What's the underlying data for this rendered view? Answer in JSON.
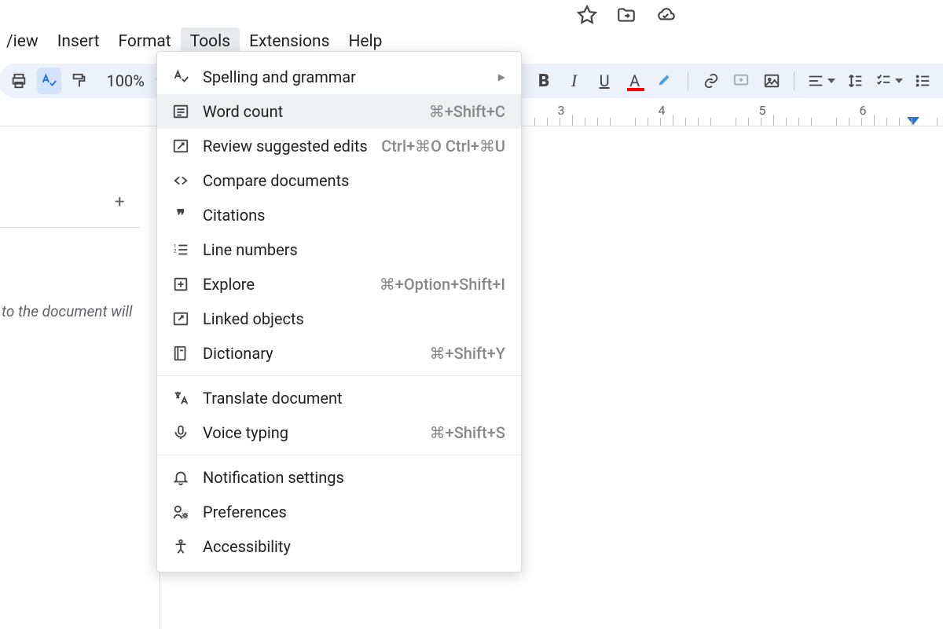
{
  "browser": {
    "star_icon": "star",
    "move_icon": "folder-arrow",
    "cloud_icon": "cloud-check"
  },
  "menubar": {
    "items": [
      {
        "label": "/iew"
      },
      {
        "label": "Insert"
      },
      {
        "label": "Format"
      },
      {
        "label": "Tools",
        "active": true
      },
      {
        "label": "Extensions"
      },
      {
        "label": "Help"
      }
    ]
  },
  "toolbar": {
    "zoom": "100%"
  },
  "ruler": {
    "labels": [
      "3",
      "4",
      "5",
      "6"
    ],
    "marker_at_label": "6"
  },
  "outline": {
    "hint": "to the document will"
  },
  "dropdown": {
    "groups": [
      [
        {
          "icon": "spellcheck",
          "label": "Spelling and grammar",
          "submenu": true
        },
        {
          "icon": "word-count",
          "label": "Word count",
          "shortcut": "⌘+Shift+C",
          "highlight": true
        },
        {
          "icon": "review",
          "label": "Review suggested edits",
          "shortcut": "Ctrl+⌘O Ctrl+⌘U"
        },
        {
          "icon": "compare",
          "label": "Compare documents"
        },
        {
          "icon": "citations",
          "label": "Citations"
        },
        {
          "icon": "line-numbers",
          "label": "Line numbers"
        },
        {
          "icon": "explore",
          "label": "Explore",
          "shortcut": "⌘+Option+Shift+I"
        },
        {
          "icon": "linked",
          "label": "Linked objects"
        },
        {
          "icon": "dictionary",
          "label": "Dictionary",
          "shortcut": "⌘+Shift+Y"
        }
      ],
      [
        {
          "icon": "translate",
          "label": "Translate document"
        },
        {
          "icon": "voice",
          "label": "Voice typing",
          "shortcut": "⌘+Shift+S"
        }
      ],
      [
        {
          "icon": "bell",
          "label": "Notification settings"
        },
        {
          "icon": "prefs",
          "label": "Preferences"
        },
        {
          "icon": "accessibility",
          "label": "Accessibility"
        }
      ]
    ]
  }
}
